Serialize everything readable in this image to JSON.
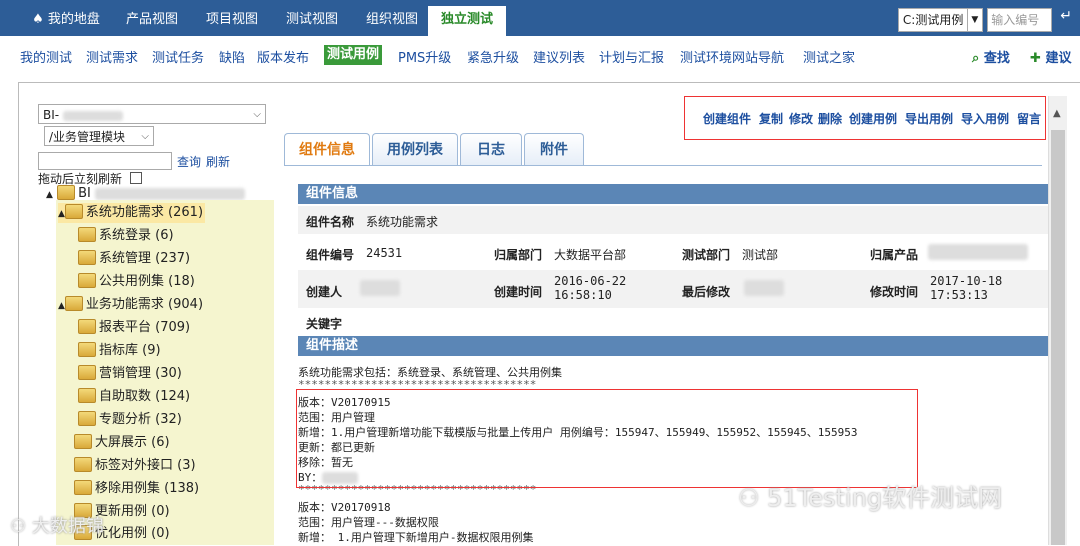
{
  "topnav": {
    "tabs": [
      {
        "label": "我的地盘"
      },
      {
        "label": "产品视图"
      },
      {
        "label": "项目视图"
      },
      {
        "label": "测试视图"
      },
      {
        "label": "组织视图"
      },
      {
        "label": "独立测试"
      }
    ],
    "search_scope": "C:测试用例",
    "search_placeholder": "输入编号"
  },
  "subnav": {
    "items": [
      "我的测试",
      "测试需求",
      "测试任务",
      "缺陷",
      "版本发布",
      "测试用例",
      "PMS升级",
      "紧急升级",
      "建议列表",
      "计划与汇报",
      "测试环境网站导航",
      "测试之家"
    ],
    "find": "查找",
    "suggest": "建议"
  },
  "leftpane": {
    "project_select": "BI-",
    "module_select": "/业务管理模块",
    "query": "查询",
    "refresh": "刷新",
    "drag_hint": "拖动后立刻刷新",
    "root": "BI",
    "tree": [
      {
        "label": "系统功能需求 (261)"
      },
      {
        "label": "系统登录 (6)"
      },
      {
        "label": "系统管理 (237)"
      },
      {
        "label": "公共用例集 (18)"
      },
      {
        "label": "业务功能需求 (904)"
      },
      {
        "label": "报表平台 (709)"
      },
      {
        "label": "指标库 (9)"
      },
      {
        "label": "营销管理 (30)"
      },
      {
        "label": "自助取数 (124)"
      },
      {
        "label": "专题分析 (32)"
      },
      {
        "label": "大屏展示 (6)"
      },
      {
        "label": "标签对外接口 (3)"
      },
      {
        "label": "移除用例集 (138)"
      },
      {
        "label": "更新用例 (0)"
      },
      {
        "label": "优化用例 (0)"
      }
    ]
  },
  "actions": [
    "创建组件",
    "复制",
    "修改",
    "删除",
    "创建用例",
    "导出用例",
    "导入用例",
    "留言"
  ],
  "tabs": [
    "组件信息",
    "用例列表",
    "日志",
    "附件"
  ],
  "info": {
    "section_title": "组件信息",
    "name_label": "组件名称",
    "name": "系统功能需求",
    "id_label": "组件编号",
    "id": "24531",
    "dept_label": "归属部门",
    "dept": "大数据平台部",
    "test_dept_label": "测试部门",
    "test_dept": "测试部",
    "product_label": "归属产品",
    "creator_label": "创建人",
    "created_label": "创建时间",
    "created": "2016-06-22 16:58:10",
    "modifier_label": "最后修改",
    "modified_label": "修改时间",
    "modified": "2017-10-18 17:53:13",
    "keyword_label": "关键字"
  },
  "desc": {
    "section_title": "组件描述",
    "lines": [
      "系统功能需求包括：系统登录、系统管理、公共用例集",
      "************************************",
      "版本：V20170915",
      "范围：用户管理",
      "新增：1.用户管理新增功能下载模版与批量上传用户 用例编号：155947、155949、155952、155945、155953",
      "更新：都已更新",
      "移除：暂无",
      "BY：",
      "************************************",
      "版本：V20170918",
      "范围：用户管理---数据权限",
      "新增：  1.用户管理下新增用户-数据权限用例集"
    ]
  },
  "watermark": "51Testing软件测试网",
  "watermark2": "大数据锦"
}
